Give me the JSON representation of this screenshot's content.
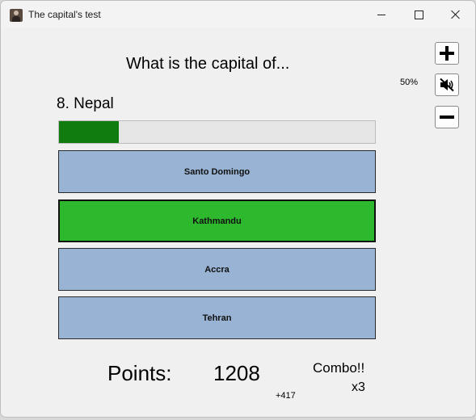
{
  "window": {
    "title": "The capital's test",
    "controls": [
      "minimize",
      "maximize",
      "close"
    ]
  },
  "quiz": {
    "question": "What is the capital of...",
    "country": "8. Nepal",
    "progress": 0.19,
    "progress_color": "#107c10",
    "answers": [
      {
        "label": "Santo Domingo",
        "state": "default"
      },
      {
        "label": "Kathmandu",
        "state": "correct"
      },
      {
        "label": "Accra",
        "state": "default"
      },
      {
        "label": "Tehran",
        "state": "default"
      }
    ],
    "answer_color": "#98b3d3",
    "correct_color": "#2eb82e"
  },
  "sound": {
    "volume_label": "50%",
    "buttons": [
      {
        "name": "volume-up",
        "icon": "plus-icon"
      },
      {
        "name": "mute",
        "icon": "speaker-muted-icon"
      },
      {
        "name": "volume-down",
        "icon": "minus-icon"
      }
    ]
  },
  "score": {
    "points_label": "Points:",
    "points_value": "1208",
    "points_gain": "+417",
    "combo_label": "Combo!!",
    "combo_value": "x3"
  }
}
